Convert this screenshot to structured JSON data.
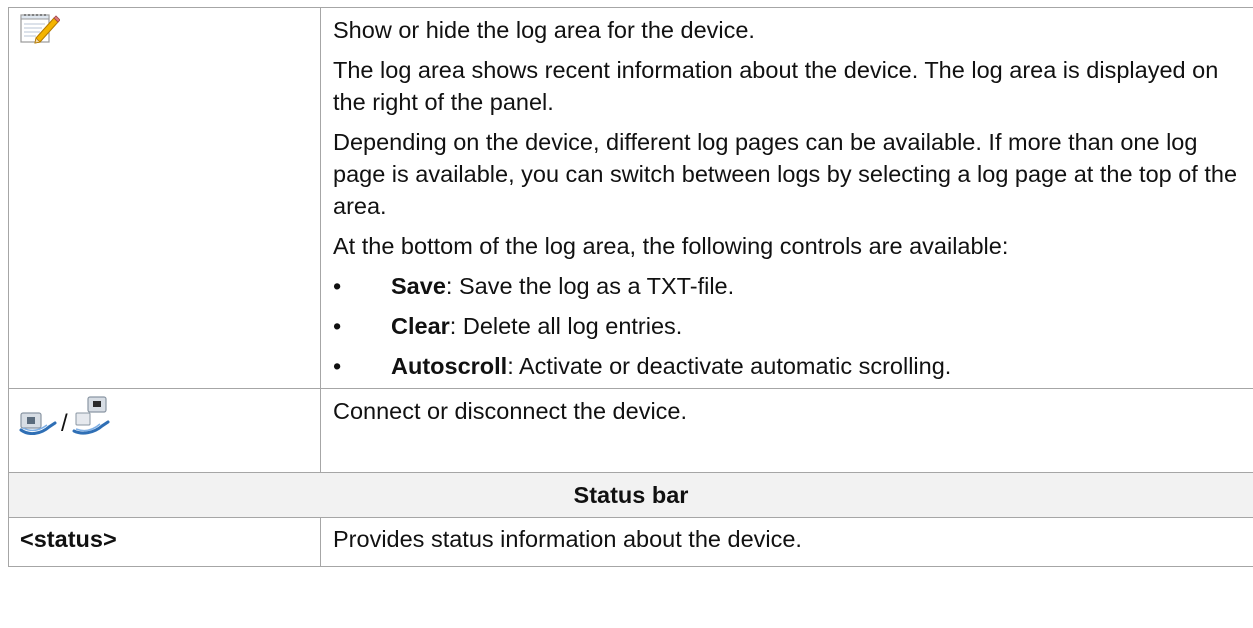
{
  "log_row": {
    "icon": "notepad-pencil-icon",
    "line1": "Show or hide the log area for the device.",
    "para2": "The log area shows recent information about the device. The log area is displayed on the right of the panel.",
    "para3": "Depending on the device, different log pages can be available. If more than one log page is available, you can switch between logs by selecting a log page at the top of the area.",
    "para4": "At the bottom of the log area, the following controls are available:",
    "bullets": [
      {
        "term": "Save",
        "desc": ": Save the log as a TXT-file."
      },
      {
        "term": "Clear",
        "desc": ": Delete all log entries."
      },
      {
        "term": "Autoscroll",
        "desc": ": Activate or deactivate automatic scrolling."
      }
    ],
    "bullet_char": "•"
  },
  "connect_row": {
    "icons": [
      "connect-cable-icon",
      "disconnect-cable-icon"
    ],
    "separator": "/",
    "text": "Connect or disconnect the device."
  },
  "status_section": {
    "heading": "Status bar",
    "label": "<status>",
    "text": "Provides status information about the device."
  },
  "colors": {
    "border": "#a6a6a6",
    "section_bg": "#f2f2f2",
    "icon_blue": "#2f6fb5"
  }
}
